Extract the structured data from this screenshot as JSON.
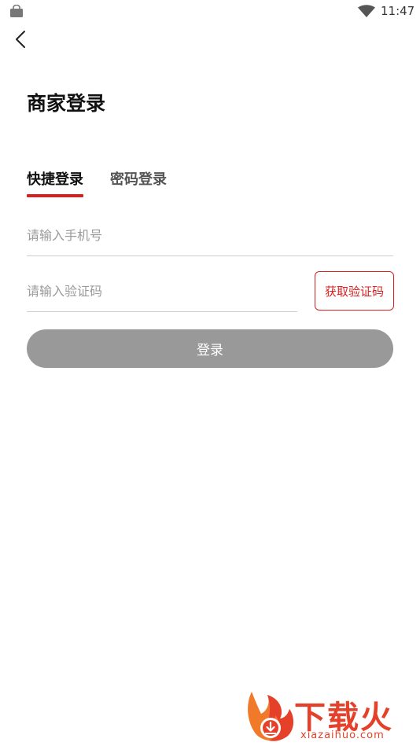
{
  "status_bar": {
    "time": "11:47",
    "icons": [
      "shopping-bag-icon",
      "wifi-icon"
    ]
  },
  "header": {
    "back_icon": "chevron-left-icon",
    "title": "商家登录"
  },
  "tabs": [
    {
      "label": "快捷登录",
      "active": true
    },
    {
      "label": "密码登录",
      "active": false
    }
  ],
  "form": {
    "phone_placeholder": "请输入手机号",
    "phone_value": "",
    "code_placeholder": "请输入验证码",
    "code_value": "",
    "get_code_label": "获取验证码",
    "login_label": "登录"
  },
  "colors": {
    "accent": "#d8201f",
    "button_disabled": "#999999",
    "divider": "#cfcfcf"
  },
  "watermark": {
    "name": "下载火",
    "url": "xiazaihuo.com"
  }
}
